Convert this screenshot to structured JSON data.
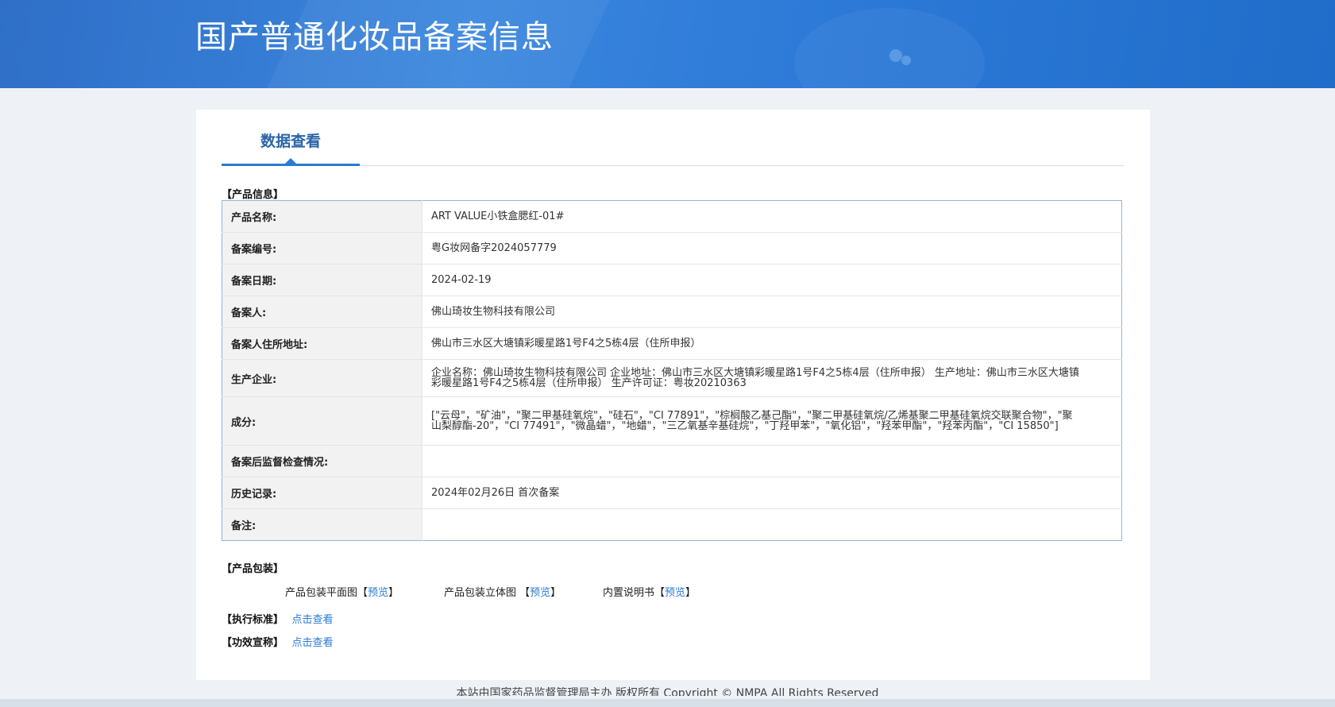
{
  "banner": {
    "title": "国产普通化妆品备案信息"
  },
  "tab": {
    "label": "数据查看"
  },
  "sections": {
    "product_info": "【产品信息】",
    "packaging": "【产品包装】",
    "standard": "【执行标准】",
    "efficacy": "【功效宣称】"
  },
  "info_rows": [
    {
      "label": "产品名称:",
      "value": "ART VALUE小铁盒腮红-01#"
    },
    {
      "label": "备案编号:",
      "value": "粤G妆网备字2024057779"
    },
    {
      "label": "备案日期:",
      "value": "2024-02-19"
    },
    {
      "label": "备案人:",
      "value": "佛山琦妆生物科技有限公司"
    },
    {
      "label": "备案人住所地址:",
      "value": "佛山市三水区大塘镇彩暖星路1号F4之5栋4层（住所申报）"
    },
    {
      "label": "生产企业:",
      "value": "企业名称：佛山琦妆生物科技有限公司 企业地址：佛山市三水区大塘镇彩暖星路1号F4之5栋4层（住所申报） 生产地址：佛山市三水区大塘镇彩暖星路1号F4之5栋4层（住所申报） 生产许可证：粤妆20210363"
    },
    {
      "label": "成分:",
      "value": "[\"云母\"，\"矿油\"，\"聚二甲基硅氧烷\"，\"硅石\"，\"CI 77891\"，\"棕榈酸乙基己酯\"，\"聚二甲基硅氧烷/乙烯基聚二甲基硅氧烷交联聚合物\"，\"聚山梨醇酯-20\"，\"CI 77491\"，\"微晶蜡\"，\"地蜡\"，\"三乙氧基辛基硅烷\"，\"丁羟甲苯\"，\"氧化铝\"，\"羟苯甲酯\"，\"羟苯丙酯\"，\"CI 15850\"]"
    },
    {
      "label": "备案后监督检查情况:",
      "value": ""
    },
    {
      "label": "历史记录:",
      "value": "2024年02月26日 首次备案"
    },
    {
      "label": "备注:",
      "value": ""
    }
  ],
  "packaging": {
    "items": [
      {
        "label": "产品包装平面图",
        "link": "预览"
      },
      {
        "label": "产品包装立体图",
        "link": "预览"
      },
      {
        "label": "内置说明书",
        "link": "预览"
      }
    ]
  },
  "links": {
    "standard": "点击查看",
    "efficacy": "点击查看"
  },
  "footer": {
    "text": "本站由国家药品监督管理局主办 版权所有 Copyright © NMPA All Rights Reserved"
  }
}
